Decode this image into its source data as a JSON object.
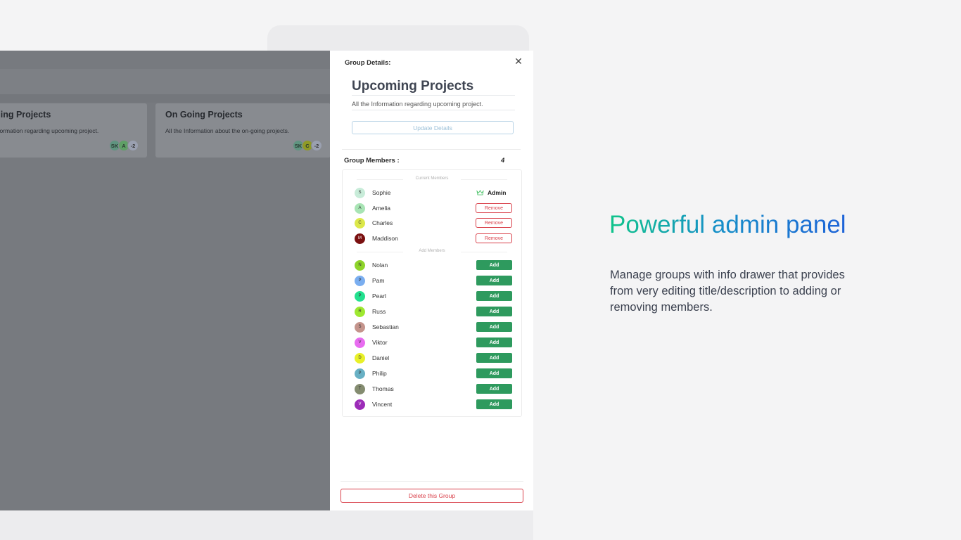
{
  "groups": [
    {
      "title": "Upcoming Projects",
      "displayed_title": "oming Projects",
      "desc": "All the Information regarding upcoming project.",
      "displayed_desc": "Information regarding upcoming project.",
      "avatars": [
        "SK",
        "A",
        "-2"
      ]
    },
    {
      "title": "On Going Projects",
      "displayed_title": "On Going Projects",
      "desc": "All the Information about the on-going projects.",
      "displayed_desc": "All the Information about the on-going projects.",
      "avatars": [
        "SK",
        "C",
        "-2"
      ]
    }
  ],
  "drawer": {
    "label": "Group Details:",
    "close_icon": "close-icon",
    "title": "Upcoming Projects",
    "description": "All the Information regarding upcoming project.",
    "update_label": "Update Details",
    "members_label": "Group Members :",
    "members_count": "4",
    "current_label": "Current Members",
    "add_label": "Add Members",
    "admin_label": "Admin",
    "remove_label": "Remove",
    "add_button_label": "Add",
    "delete_label": "Delete this Group",
    "current_members": [
      {
        "initial": "S",
        "name": "Sophie",
        "color": "#c8ecd9",
        "role": "admin"
      },
      {
        "initial": "A",
        "name": "Amelia",
        "color": "#a8e4b4",
        "role": "member"
      },
      {
        "initial": "C",
        "name": "Charles",
        "color": "#dce84a",
        "role": "member"
      },
      {
        "initial": "M",
        "name": "Maddison",
        "color": "#7a1010",
        "role": "member"
      }
    ],
    "add_members": [
      {
        "initial": "N",
        "name": "Nolan",
        "color": "#8ed42a"
      },
      {
        "initial": "P",
        "name": "Pam",
        "color": "#7aaef0"
      },
      {
        "initial": "P",
        "name": "Pearl",
        "color": "#22e08e"
      },
      {
        "initial": "R",
        "name": "Russ",
        "color": "#9ee830"
      },
      {
        "initial": "S",
        "name": "Sebastian",
        "color": "#c4948c"
      },
      {
        "initial": "V",
        "name": "Viktor",
        "color": "#e86cf0"
      },
      {
        "initial": "D",
        "name": "Daniel",
        "color": "#e8f028"
      },
      {
        "initial": "P",
        "name": "Philip",
        "color": "#68b0c4"
      },
      {
        "initial": "T",
        "name": "Thomas",
        "color": "#848c70"
      },
      {
        "initial": "V",
        "name": "Vincent",
        "color": "#9c2cb8"
      }
    ]
  },
  "marketing": {
    "headline": "Powerful admin panel",
    "body": "Manage groups with info drawer that provides from very editing title/description to adding or removing members."
  }
}
